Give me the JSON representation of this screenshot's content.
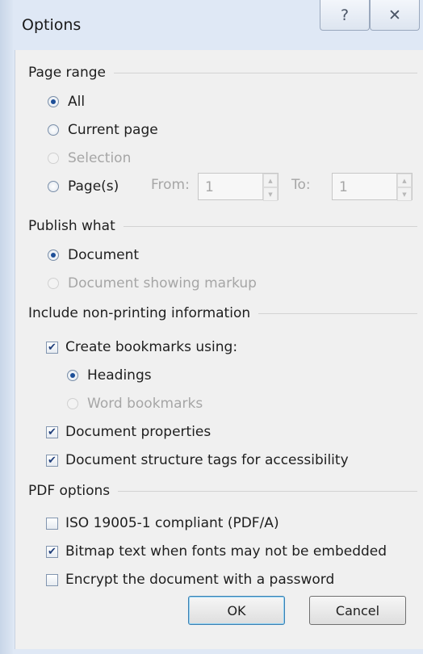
{
  "window": {
    "title": "Options",
    "help_icon": "?",
    "close_icon": "✕"
  },
  "page_range": {
    "heading": "Page range",
    "all": "All",
    "current_page": "Current page",
    "selection": "Selection",
    "pages": "Page(s)",
    "from_label": "From:",
    "from_value": "1",
    "to_label": "To:",
    "to_value": "1"
  },
  "publish_what": {
    "heading": "Publish what",
    "document": "Document",
    "document_markup": "Document showing markup"
  },
  "non_printing": {
    "heading": "Include non-printing information",
    "create_bookmarks": "Create bookmarks using:",
    "headings": "Headings",
    "word_bookmarks": "Word bookmarks",
    "doc_properties": "Document properties",
    "structure_tags": "Document structure tags for accessibility"
  },
  "pdf_options": {
    "heading": "PDF options",
    "iso": "ISO 19005-1 compliant (PDF/A)",
    "bitmap_text": "Bitmap text when fonts may not be embedded",
    "encrypt": "Encrypt the document with a password"
  },
  "buttons": {
    "ok": "OK",
    "cancel": "Cancel"
  }
}
